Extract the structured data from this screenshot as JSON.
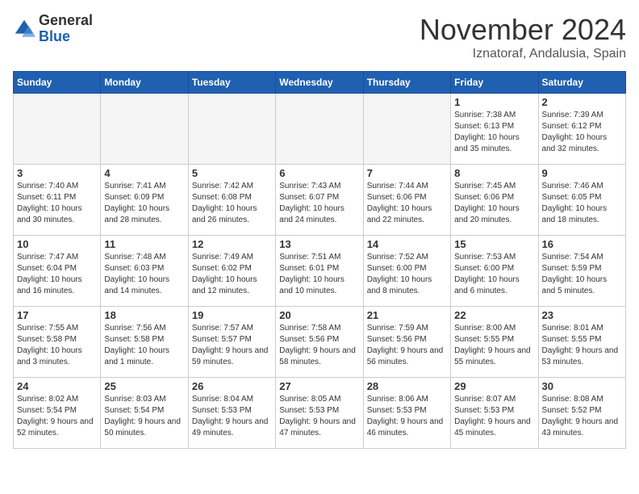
{
  "header": {
    "logo_general": "General",
    "logo_blue": "Blue",
    "month": "November 2024",
    "location": "Iznatoraf, Andalusia, Spain"
  },
  "weekdays": [
    "Sunday",
    "Monday",
    "Tuesday",
    "Wednesday",
    "Thursday",
    "Friday",
    "Saturday"
  ],
  "weeks": [
    [
      {
        "day": "",
        "info": ""
      },
      {
        "day": "",
        "info": ""
      },
      {
        "day": "",
        "info": ""
      },
      {
        "day": "",
        "info": ""
      },
      {
        "day": "",
        "info": ""
      },
      {
        "day": "1",
        "info": "Sunrise: 7:38 AM\nSunset: 6:13 PM\nDaylight: 10 hours and 35 minutes."
      },
      {
        "day": "2",
        "info": "Sunrise: 7:39 AM\nSunset: 6:12 PM\nDaylight: 10 hours and 32 minutes."
      }
    ],
    [
      {
        "day": "3",
        "info": "Sunrise: 7:40 AM\nSunset: 6:11 PM\nDaylight: 10 hours and 30 minutes."
      },
      {
        "day": "4",
        "info": "Sunrise: 7:41 AM\nSunset: 6:09 PM\nDaylight: 10 hours and 28 minutes."
      },
      {
        "day": "5",
        "info": "Sunrise: 7:42 AM\nSunset: 6:08 PM\nDaylight: 10 hours and 26 minutes."
      },
      {
        "day": "6",
        "info": "Sunrise: 7:43 AM\nSunset: 6:07 PM\nDaylight: 10 hours and 24 minutes."
      },
      {
        "day": "7",
        "info": "Sunrise: 7:44 AM\nSunset: 6:06 PM\nDaylight: 10 hours and 22 minutes."
      },
      {
        "day": "8",
        "info": "Sunrise: 7:45 AM\nSunset: 6:06 PM\nDaylight: 10 hours and 20 minutes."
      },
      {
        "day": "9",
        "info": "Sunrise: 7:46 AM\nSunset: 6:05 PM\nDaylight: 10 hours and 18 minutes."
      }
    ],
    [
      {
        "day": "10",
        "info": "Sunrise: 7:47 AM\nSunset: 6:04 PM\nDaylight: 10 hours and 16 minutes."
      },
      {
        "day": "11",
        "info": "Sunrise: 7:48 AM\nSunset: 6:03 PM\nDaylight: 10 hours and 14 minutes."
      },
      {
        "day": "12",
        "info": "Sunrise: 7:49 AM\nSunset: 6:02 PM\nDaylight: 10 hours and 12 minutes."
      },
      {
        "day": "13",
        "info": "Sunrise: 7:51 AM\nSunset: 6:01 PM\nDaylight: 10 hours and 10 minutes."
      },
      {
        "day": "14",
        "info": "Sunrise: 7:52 AM\nSunset: 6:00 PM\nDaylight: 10 hours and 8 minutes."
      },
      {
        "day": "15",
        "info": "Sunrise: 7:53 AM\nSunset: 6:00 PM\nDaylight: 10 hours and 6 minutes."
      },
      {
        "day": "16",
        "info": "Sunrise: 7:54 AM\nSunset: 5:59 PM\nDaylight: 10 hours and 5 minutes."
      }
    ],
    [
      {
        "day": "17",
        "info": "Sunrise: 7:55 AM\nSunset: 5:58 PM\nDaylight: 10 hours and 3 minutes."
      },
      {
        "day": "18",
        "info": "Sunrise: 7:56 AM\nSunset: 5:58 PM\nDaylight: 10 hours and 1 minute."
      },
      {
        "day": "19",
        "info": "Sunrise: 7:57 AM\nSunset: 5:57 PM\nDaylight: 9 hours and 59 minutes."
      },
      {
        "day": "20",
        "info": "Sunrise: 7:58 AM\nSunset: 5:56 PM\nDaylight: 9 hours and 58 minutes."
      },
      {
        "day": "21",
        "info": "Sunrise: 7:59 AM\nSunset: 5:56 PM\nDaylight: 9 hours and 56 minutes."
      },
      {
        "day": "22",
        "info": "Sunrise: 8:00 AM\nSunset: 5:55 PM\nDaylight: 9 hours and 55 minutes."
      },
      {
        "day": "23",
        "info": "Sunrise: 8:01 AM\nSunset: 5:55 PM\nDaylight: 9 hours and 53 minutes."
      }
    ],
    [
      {
        "day": "24",
        "info": "Sunrise: 8:02 AM\nSunset: 5:54 PM\nDaylight: 9 hours and 52 minutes."
      },
      {
        "day": "25",
        "info": "Sunrise: 8:03 AM\nSunset: 5:54 PM\nDaylight: 9 hours and 50 minutes."
      },
      {
        "day": "26",
        "info": "Sunrise: 8:04 AM\nSunset: 5:53 PM\nDaylight: 9 hours and 49 minutes."
      },
      {
        "day": "27",
        "info": "Sunrise: 8:05 AM\nSunset: 5:53 PM\nDaylight: 9 hours and 47 minutes."
      },
      {
        "day": "28",
        "info": "Sunrise: 8:06 AM\nSunset: 5:53 PM\nDaylight: 9 hours and 46 minutes."
      },
      {
        "day": "29",
        "info": "Sunrise: 8:07 AM\nSunset: 5:53 PM\nDaylight: 9 hours and 45 minutes."
      },
      {
        "day": "30",
        "info": "Sunrise: 8:08 AM\nSunset: 5:52 PM\nDaylight: 9 hours and 43 minutes."
      }
    ]
  ]
}
